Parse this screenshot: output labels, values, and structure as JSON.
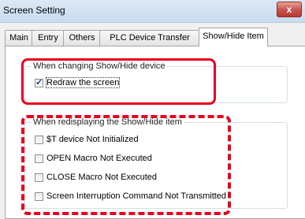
{
  "window": {
    "title": "Screen Setting",
    "close_glyph": "x"
  },
  "tabs": [
    {
      "label": "Main",
      "active": false
    },
    {
      "label": "Entry",
      "active": false
    },
    {
      "label": "Others",
      "active": false
    },
    {
      "label": "PLC Device Transfer",
      "active": false
    },
    {
      "label": "Show/Hide Item",
      "active": true
    }
  ],
  "group_changing": {
    "legend": "When changing Show/Hide device",
    "items": [
      {
        "label": "Redraw the screen",
        "checked": true
      }
    ]
  },
  "group_redisplaying": {
    "legend": "When redisplaying the Show/Hide item",
    "items": [
      {
        "label": "$T device Not Initialized",
        "checked": false
      },
      {
        "label": "OPEN Macro Not Executed",
        "checked": false
      },
      {
        "label": "CLOSE Macro Not Executed",
        "checked": false
      },
      {
        "label": "Screen Interruption Command Not Transmitted",
        "checked": false
      }
    ]
  },
  "colors": {
    "highlight": "#e8001e",
    "checkmark": "#1d3f86"
  }
}
